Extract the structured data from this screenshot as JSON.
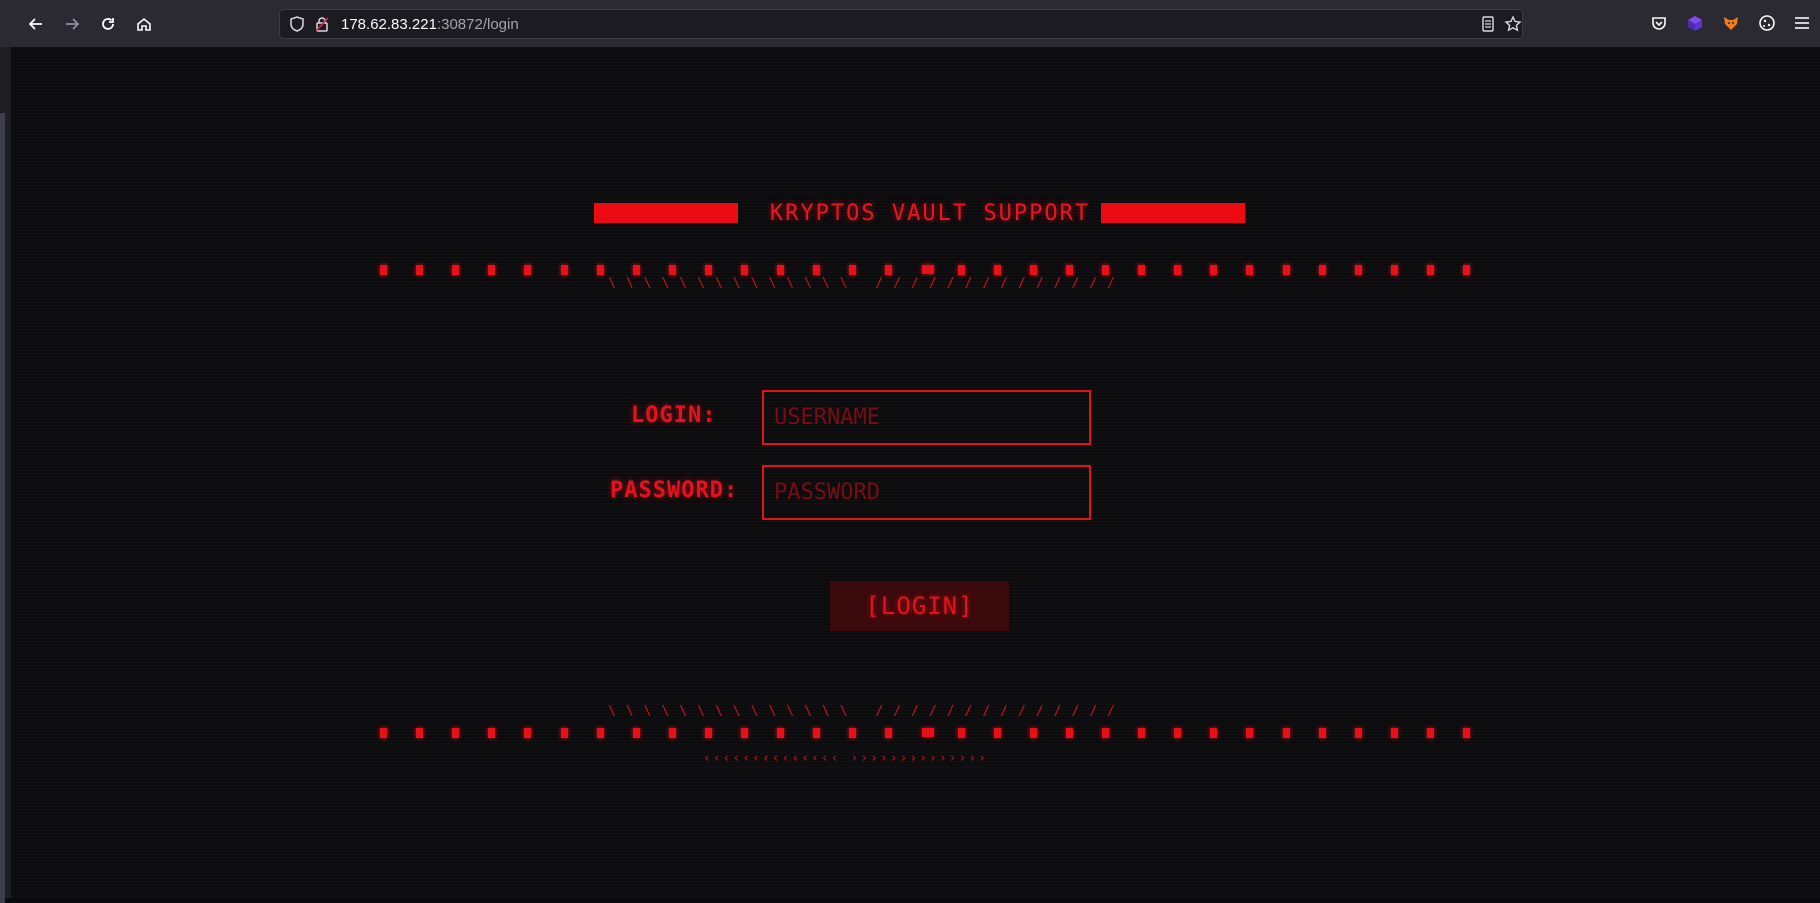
{
  "browser": {
    "url_host": "178.62.83.221",
    "url_rest": ":30872/login"
  },
  "page": {
    "title": "KRYPTOS VAULT SUPPORT",
    "login_label": "LOGIN:",
    "password_label": "PASSWORD:",
    "username_placeholder": "USERNAME",
    "password_placeholder": "PASSWORD",
    "username_value": "",
    "password_value": "",
    "login_button": "[LOGIN]",
    "slashes_top": "\\\\\\\\\\\\\\\\\\\\\\\\\\\\ //////////////",
    "slashes_bottom": "\\\\\\\\\\\\\\\\\\\\\\\\\\\\ //////////////",
    "arrows_bottom": "‹‹‹‹‹‹‹‹‹‹‹‹‹‹ ››››››››››››››"
  },
  "colors": {
    "accent": "#e8111c",
    "background": "#0c0b0d",
    "button_bg": "#3a0a0c"
  }
}
